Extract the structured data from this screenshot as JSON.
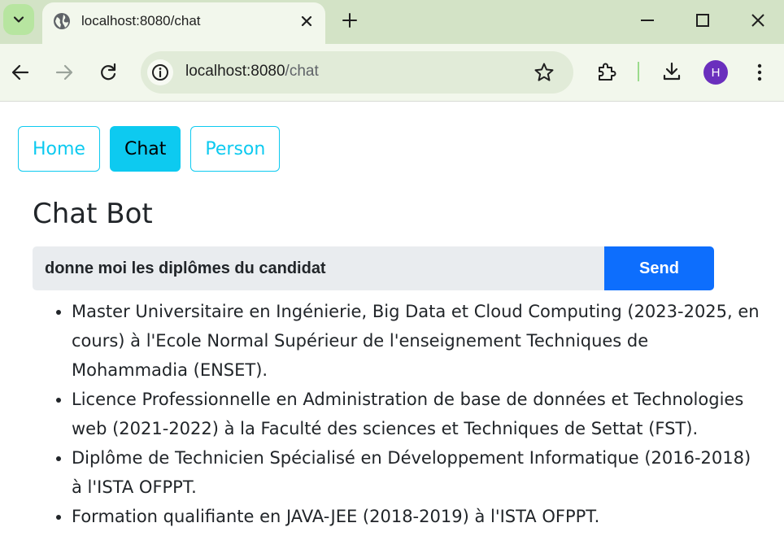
{
  "browser": {
    "tab_title": "localhost:8080/chat",
    "url_host": "localhost:8080",
    "url_path": "/chat",
    "avatar_letter": "H",
    "colors": {
      "frame": "#d3e3c6",
      "toolbar": "#f2f7ec",
      "avatar": "#6a2fbd"
    }
  },
  "nav": {
    "items": [
      {
        "label": "Home",
        "active": false
      },
      {
        "label": "Chat",
        "active": true
      },
      {
        "label": "Person",
        "active": false
      }
    ]
  },
  "chat": {
    "title": "Chat Bot",
    "input_value": "donne moi les diplômes du candidat",
    "send_label": "Send",
    "answers": [
      "Master Universitaire en Ingénierie, Big Data et Cloud Computing (2023-2025, en cours) à l'Ecole Normal Supérieur de l'enseignement Techniques de Mohammadia (ENSET).",
      "Licence Professionnelle en Administration de base de données et Technologies web (2021-2022) à la Faculté des sciences et Techniques de Settat (FST).",
      "Diplôme de Technicien Spécialisé en Développement Informatique (2016-2018) à l'ISTA OFPPT.",
      "Formation qualifiante en JAVA-JEE (2018-2019) à l'ISTA OFPPT."
    ]
  },
  "colors": {
    "info": "#0dcaf0",
    "primary": "#0d6efd",
    "input_bg": "#e9ecef"
  }
}
